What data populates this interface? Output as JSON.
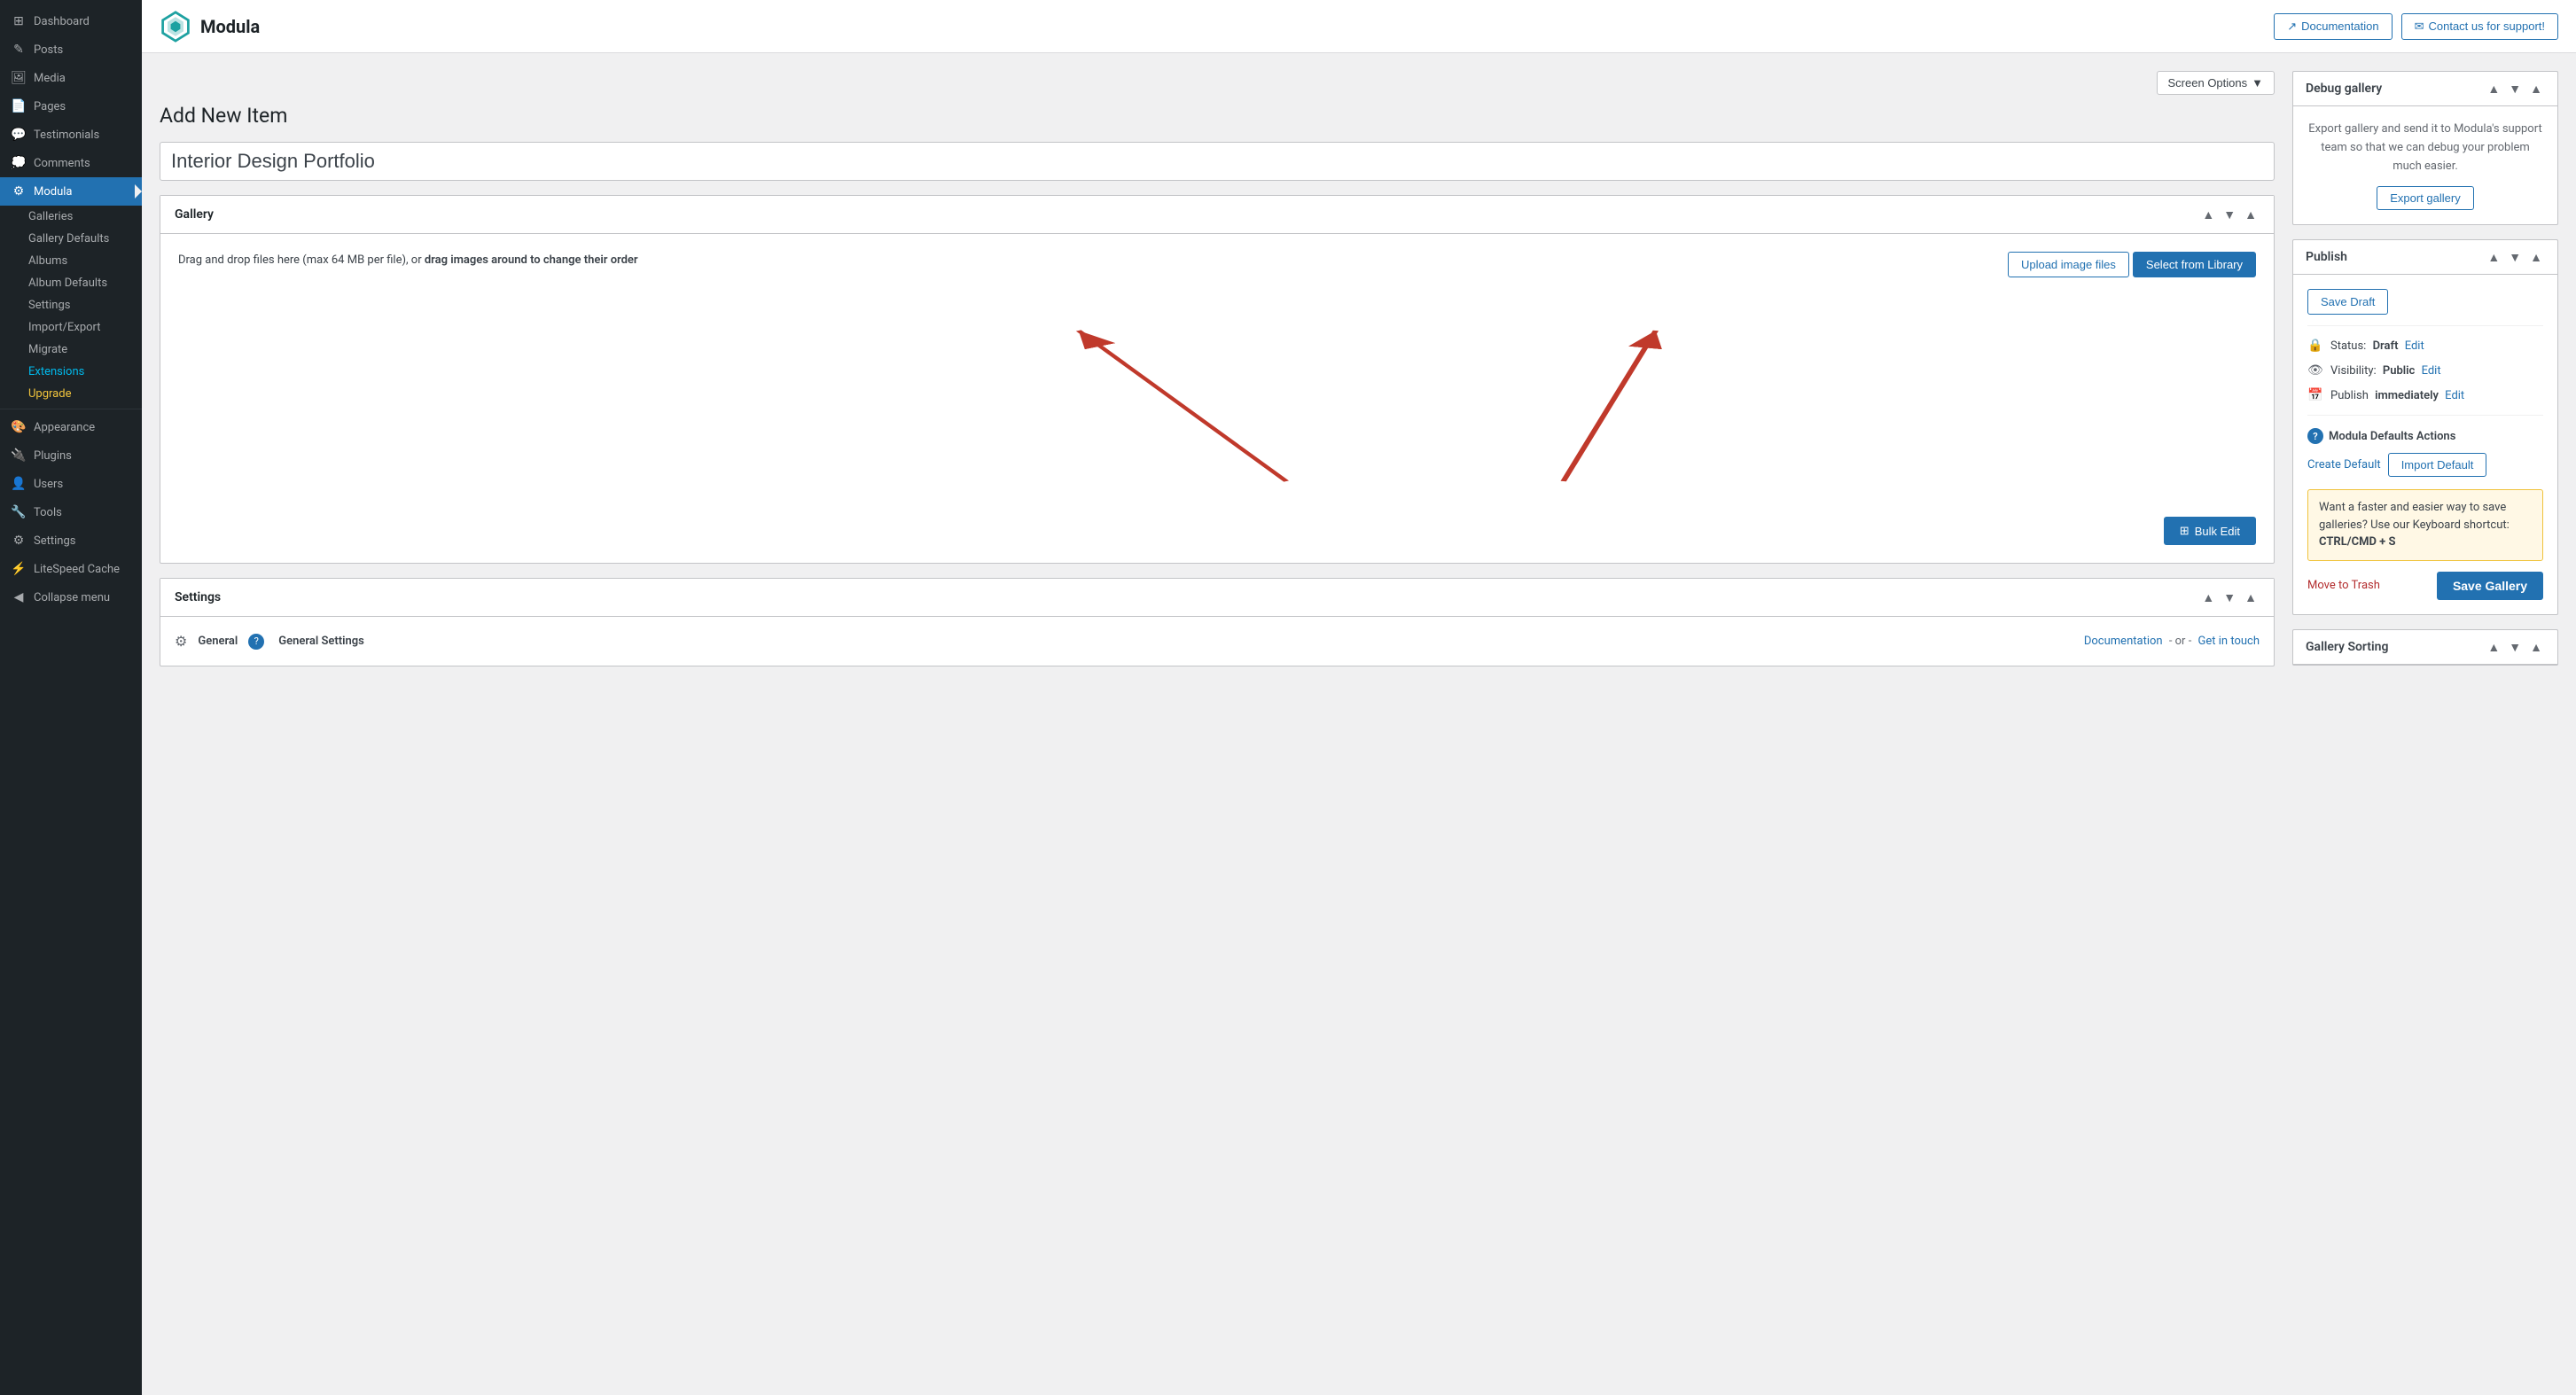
{
  "sidebar": {
    "items": [
      {
        "id": "dashboard",
        "label": "Dashboard",
        "icon": "⊞"
      },
      {
        "id": "posts",
        "label": "Posts",
        "icon": "✎"
      },
      {
        "id": "media",
        "label": "Media",
        "icon": "🖼"
      },
      {
        "id": "pages",
        "label": "Pages",
        "icon": "📄"
      },
      {
        "id": "testimonials",
        "label": "Testimonials",
        "icon": "💬"
      },
      {
        "id": "comments",
        "label": "Comments",
        "icon": "💭"
      },
      {
        "id": "modula",
        "label": "Modula",
        "icon": "⚙",
        "active": true
      }
    ],
    "modula_sub": [
      {
        "id": "galleries",
        "label": "Galleries"
      },
      {
        "id": "gallery-defaults",
        "label": "Gallery Defaults"
      },
      {
        "id": "albums",
        "label": "Albums"
      },
      {
        "id": "album-defaults",
        "label": "Album Defaults"
      },
      {
        "id": "settings",
        "label": "Settings"
      },
      {
        "id": "import-export",
        "label": "Import/Export"
      },
      {
        "id": "migrate",
        "label": "Migrate"
      },
      {
        "id": "extensions",
        "label": "Extensions",
        "green": true
      },
      {
        "id": "upgrade",
        "label": "Upgrade",
        "yellow": true
      }
    ],
    "bottom_items": [
      {
        "id": "appearance",
        "label": "Appearance",
        "icon": "🎨"
      },
      {
        "id": "plugins",
        "label": "Plugins",
        "icon": "🔌"
      },
      {
        "id": "users",
        "label": "Users",
        "icon": "👤"
      },
      {
        "id": "tools",
        "label": "Tools",
        "icon": "🔧"
      },
      {
        "id": "settings-bottom",
        "label": "Settings",
        "icon": "⚙"
      },
      {
        "id": "litespeed",
        "label": "LiteSpeed Cache",
        "icon": "⚡"
      },
      {
        "id": "collapse",
        "label": "Collapse menu",
        "icon": "◀"
      }
    ]
  },
  "topbar": {
    "logo_text": "Modula",
    "doc_btn": "Documentation",
    "support_btn": "Contact us for support!"
  },
  "screen_options": {
    "label": "Screen Options"
  },
  "page": {
    "title": "Add New Item",
    "gallery_name_placeholder": "Interior Design Portfolio",
    "gallery_name_value": "Interior Design Portfolio"
  },
  "gallery_panel": {
    "title": "Gallery",
    "dropzone_text": "Drag and drop files here (max 64 MB per file), or",
    "dropzone_bold": "drag images around to change their order",
    "upload_btn": "Upload image files",
    "library_btn": "Select from Library",
    "bulk_edit_btn": "Bulk Edit",
    "bulk_edit_icon": "⊞"
  },
  "settings_panel": {
    "title": "Settings",
    "general_icon": "⚙",
    "general_label": "General",
    "general_settings_label": "General Settings",
    "help_icon": "?",
    "doc_text": "Documentation",
    "or_text": "- or -",
    "contact_text": "Get in touch"
  },
  "debug_panel": {
    "title": "Debug gallery",
    "description": "Export gallery and send it to Modula's support team so that we can debug your problem much easier.",
    "export_btn": "Export gallery"
  },
  "publish_panel": {
    "title": "Publish",
    "save_draft_btn": "Save Draft",
    "status_label": "Status:",
    "status_value": "Draft",
    "status_edit": "Edit",
    "visibility_label": "Visibility:",
    "visibility_value": "Public",
    "visibility_edit": "Edit",
    "publish_label": "Publish",
    "publish_value": "immediately",
    "publish_edit": "Edit",
    "defaults_label": "Modula Defaults Actions",
    "create_default": "Create Default",
    "import_default": "Import Default",
    "note_text": "Want a faster and easier way to save galleries? Use our Keyboard shortcut:",
    "note_shortcut": "CTRL/CMD + S",
    "trash_link": "Move to Trash",
    "save_gallery_btn": "Save Gallery"
  },
  "gallery_sorting_panel": {
    "title": "Gallery Sorting"
  },
  "colors": {
    "primary": "#2271b1",
    "sidebar_bg": "#1d2327",
    "active_bg": "#2271b1",
    "arrow_red": "#c0392b",
    "extensions_green": "#00b9eb",
    "upgrade_yellow": "#f0c33c"
  }
}
